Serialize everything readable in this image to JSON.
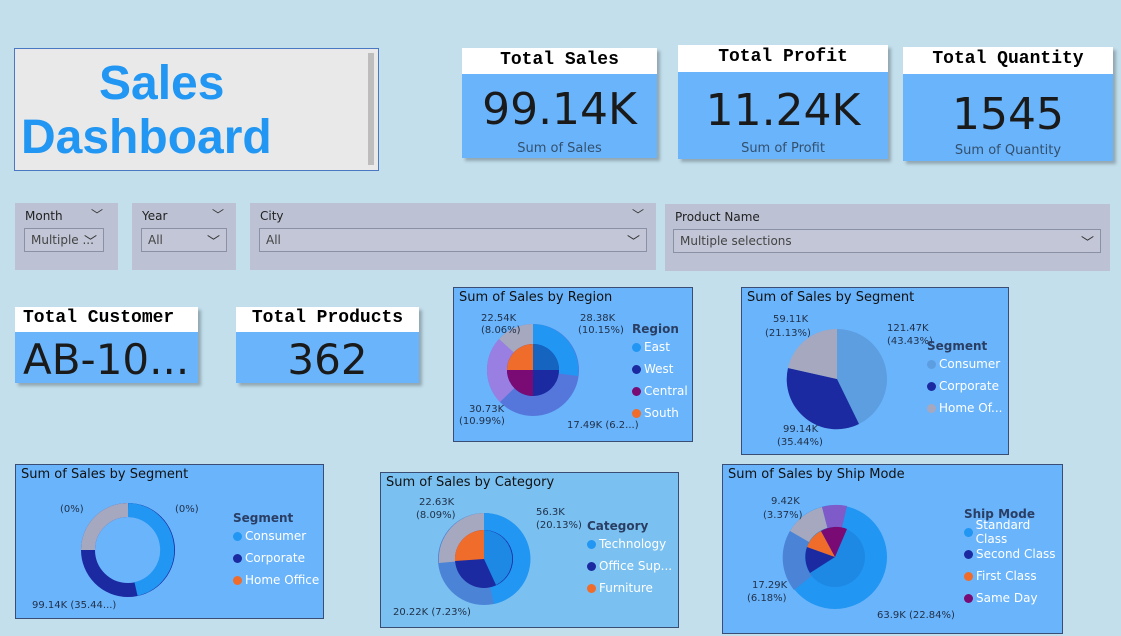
{
  "title": {
    "line1": "Sales",
    "line2": "Dashboard"
  },
  "kpis": {
    "sales": {
      "header": "Total Sales",
      "value": "99.14K",
      "sub": "Sum of Sales"
    },
    "profit": {
      "header": "Total Profit",
      "value": "11.24K",
      "sub": "Sum of Profit"
    },
    "quantity": {
      "header": "Total Quantity",
      "value": "1545",
      "sub": "Sum of Quantity"
    },
    "customer": {
      "header": "Total Customer",
      "value": "AB-10..."
    },
    "products": {
      "header": "Total Products",
      "value": "362"
    }
  },
  "slicers": {
    "month": {
      "label": "Month",
      "value": "Multiple ..."
    },
    "year": {
      "label": "Year",
      "value": "All"
    },
    "city": {
      "label": "City",
      "value": "All"
    },
    "product": {
      "label": "Product Name",
      "value": "Multiple selections"
    }
  },
  "icons": {
    "chevron": "chevron-down-icon"
  },
  "colors": {
    "accent": "#2196f3",
    "panel": "#6ab4fb",
    "bg": "#c3dfec"
  },
  "charts": {
    "region": {
      "title": "Sum of Sales by Region",
      "legend_title": "Region",
      "legend": [
        "East",
        "West",
        "Central",
        "South"
      ],
      "labels": {
        "a": "28.38K",
        "a2": "(10.15%)",
        "b": "22.54K",
        "b2": "(8.06%)",
        "c": "30.73K",
        "c2": "(10.99%)",
        "d": "17.49K (6.2...)"
      }
    },
    "segment1": {
      "title": "Sum of Sales by Segment",
      "legend_title": "Segment",
      "legend": [
        "Consumer",
        "Corporate",
        "Home Of..."
      ],
      "labels": {
        "a": "121.47K",
        "a2": "(43.43%)",
        "b": "59.11K",
        "b2": "(21.13%)",
        "c": "99.14K",
        "c2": "(35.44%)"
      }
    },
    "segment2": {
      "title": "Sum of Sales by Segment",
      "legend_title": "Segment",
      "legend": [
        "Consumer",
        "Corporate",
        "Home Office"
      ],
      "labels": {
        "a": "(0%)",
        "b": "(0%)",
        "c": "99.14K (35.44...)"
      }
    },
    "category": {
      "title": "Sum of Sales by Category",
      "legend_title": "Category",
      "legend": [
        "Technology",
        "Office Sup...",
        "Furniture"
      ],
      "labels": {
        "a": "56.3K",
        "a2": "(20.13%)",
        "b": "22.63K",
        "b2": "(8.09%)",
        "c": "20.22K (7.23%)"
      }
    },
    "shipmode": {
      "title": "Sum of Sales by Ship Mode",
      "legend_title": "Ship Mode",
      "legend": [
        "Standard Class",
        "Second Class",
        "First Class",
        "Same Day"
      ],
      "labels": {
        "a": "9.42K",
        "a2": "(3.37%)",
        "b": "17.29K",
        "b2": "(6.18%)",
        "c": "63.9K (22.84%)"
      }
    }
  },
  "chart_data": [
    {
      "type": "pie",
      "title": "Sum of Sales by Region",
      "categories": [
        "East",
        "West",
        "Central",
        "South"
      ],
      "outer_values_K": [
        28.38,
        17.49,
        30.73,
        22.54
      ],
      "outer_percent": [
        10.15,
        6.25,
        10.99,
        8.06
      ]
    },
    {
      "type": "pie",
      "title": "Sum of Sales by Segment",
      "categories": [
        "Consumer",
        "Corporate",
        "Home Office"
      ],
      "values_K": [
        121.47,
        99.14,
        59.11
      ],
      "percent": [
        43.43,
        35.44,
        21.13
      ]
    },
    {
      "type": "pie",
      "title": "Sum of Sales by Segment",
      "categories": [
        "Consumer",
        "Corporate",
        "Home Office"
      ],
      "values_K": [
        null,
        99.14,
        null
      ],
      "percent": [
        0,
        35.44,
        0
      ]
    },
    {
      "type": "pie",
      "title": "Sum of Sales by Category",
      "categories": [
        "Technology",
        "Office Supplies",
        "Furniture"
      ],
      "values_K": [
        56.3,
        20.22,
        22.63
      ],
      "percent": [
        20.13,
        7.23,
        8.09
      ]
    },
    {
      "type": "pie",
      "title": "Sum of Sales by Ship Mode",
      "categories": [
        "Standard Class",
        "Second Class",
        "First Class",
        "Same Day"
      ],
      "values_K": [
        63.9,
        17.29,
        9.42,
        null
      ],
      "percent": [
        22.84,
        6.18,
        3.37,
        null
      ]
    }
  ]
}
